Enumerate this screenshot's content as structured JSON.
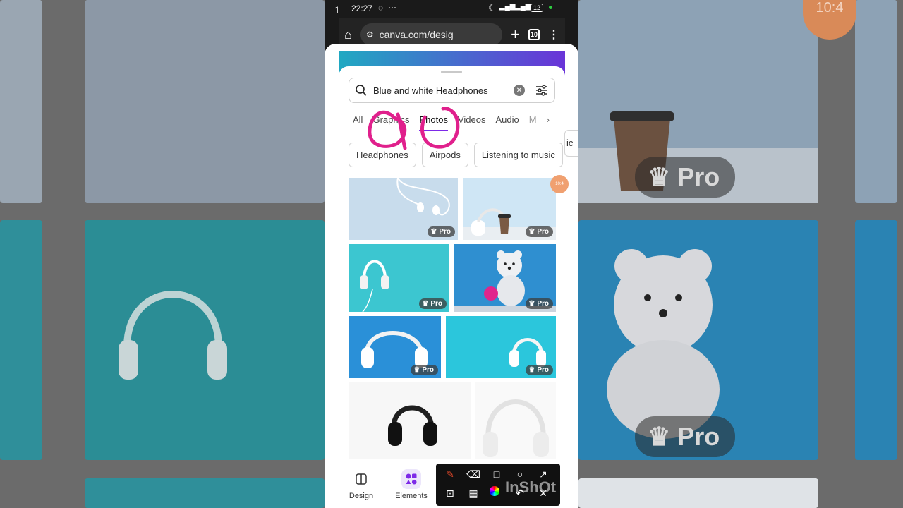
{
  "status_bar": {
    "edge_digit": "1",
    "time": "22:27",
    "battery": "12"
  },
  "browser": {
    "url": "canva.com/desig",
    "tab_count": "10"
  },
  "search": {
    "query": "Blue and white Headphones"
  },
  "tabs": [
    "All",
    "Graphics",
    "Photos",
    "Videos",
    "Audio",
    "M"
  ],
  "active_tab": "Photos",
  "chips": [
    "Headphones",
    "Airpods",
    "Listening to music"
  ],
  "partial_chip_text": "ic",
  "pro_label": "Pro",
  "bottom_nav": {
    "design": "Design",
    "elements": "Elements"
  },
  "overlays": {
    "small_timestamp": "10:4",
    "big_timestamp": "10:4",
    "watermark": "InShOt"
  },
  "colors": {
    "accent": "#7d2ae8",
    "annotation": "#e0208c"
  }
}
